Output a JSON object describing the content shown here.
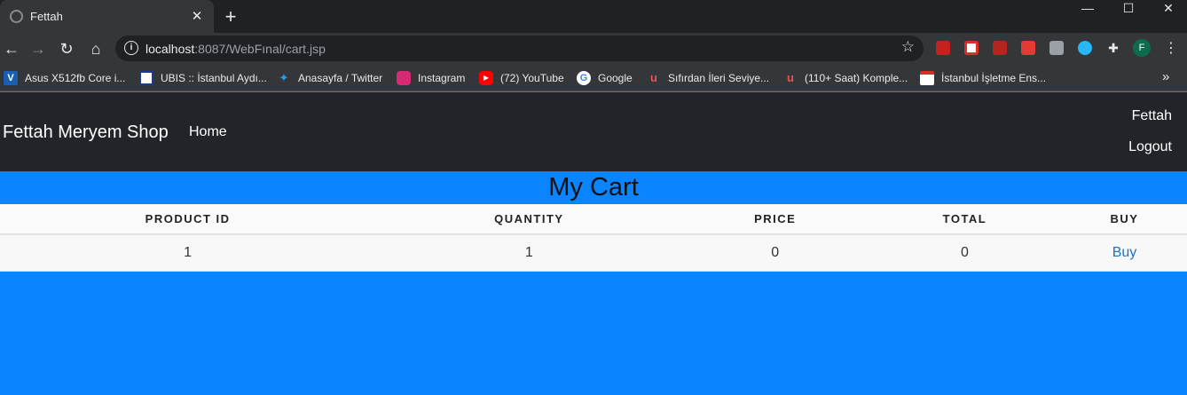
{
  "browser": {
    "tab_title": "Fettah",
    "tab_close": "✕",
    "new_tab": "+",
    "window_controls": {
      "minimize": "—",
      "maximize": "☐",
      "close": "✕"
    },
    "url_host": "localhost",
    "url_rest": ":8087/WebFınal/cart.jsp",
    "profile_initial": "F",
    "bookmarks": [
      {
        "label": "Asus X512fb Core i...",
        "icon": "v-logo-icon",
        "color": "#1a5fb4"
      },
      {
        "label": "UBIS :: İstanbul Aydı...",
        "icon": "ubis-icon",
        "color": "#1b3a8a"
      },
      {
        "label": "Anasayfa / Twitter",
        "icon": "twitter-icon",
        "color": "#1da1f2"
      },
      {
        "label": "Instagram",
        "icon": "instagram-icon",
        "color": "#d62976"
      },
      {
        "label": "(72) YouTube",
        "icon": "youtube-icon",
        "color": "#ff0000"
      },
      {
        "label": "Google",
        "icon": "google-icon",
        "color": "#ffffff"
      },
      {
        "label": "Sıfırdan İleri Seviye...",
        "icon": "udemy-icon",
        "color": "#ec5252"
      },
      {
        "label": "(110+ Saat) Komple...",
        "icon": "udemy-icon",
        "color": "#ec5252"
      },
      {
        "label": "İstanbul İşletme Ens...",
        "icon": "calendar-icon",
        "color": "#d93025"
      }
    ]
  },
  "page": {
    "brand": "Fettah Meryem Shop",
    "nav_home": "Home",
    "user_name": "Fettah",
    "logout": "Logout",
    "cart_title": "My Cart",
    "table": {
      "headers": [
        "PRODUCT ID",
        "QUANTITY",
        "PRICE",
        "TOTAL",
        "BUY"
      ],
      "rows": [
        {
          "product_id": "1",
          "quantity": "1",
          "price": "0",
          "total": "0",
          "buy": "Buy"
        }
      ]
    }
  },
  "colors": {
    "page_background": "#0a84ff",
    "navbar": "#212529",
    "buy_link": "#1e73be"
  }
}
